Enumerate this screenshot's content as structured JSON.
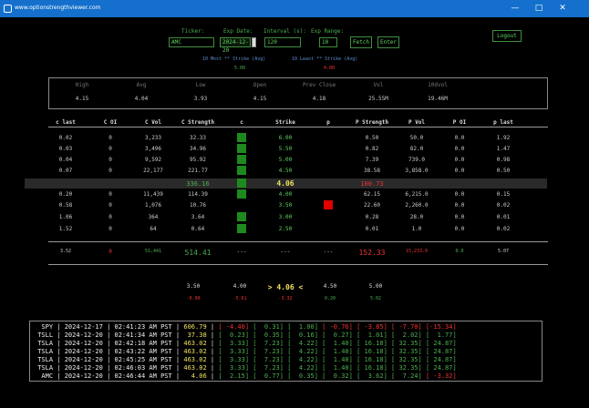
{
  "window": {
    "title": "www.optionstrengthviewer.com",
    "minimize": "—",
    "maximize": "□",
    "close": "✕"
  },
  "form": {
    "ticker_label": "Ticker:",
    "ticker_value": "AMC",
    "exp_label": "Exp Date:",
    "exp_value": "2024-12-20",
    "interval_label": "Interval (s):",
    "interval_value": "120",
    "range_label": "Exp Range:",
    "range_value": "10",
    "fetch": "Fetch",
    "enter": "Enter",
    "logout": "Logout"
  },
  "most": {
    "label": "10 Most ** Strike (Avg)",
    "value": "5.00"
  },
  "least": {
    "label": "10 Least ** Strike (Avg)",
    "value": "4.00"
  },
  "stats": {
    "headers": [
      "High",
      "Avg",
      "Low",
      "Open",
      "Prev Close",
      "Vol",
      "10dvol"
    ],
    "values": [
      "4.15",
      "4.04",
      "3.93",
      "4.15",
      "4.18",
      "25.55M",
      "19.46M"
    ]
  },
  "chain": {
    "headers": [
      "c last",
      "C OI",
      "C Vol",
      "C Strength",
      "c",
      "Strike",
      "p",
      "P Strength",
      "P Vol",
      "P OI",
      "p last"
    ],
    "rows": [
      [
        "0.02",
        "0",
        "3,233",
        "32.33",
        "6.00",
        "0.50",
        "50.0",
        "0.0",
        "1.92"
      ],
      [
        "0.03",
        "0",
        "3,496",
        "34.96",
        "5.50",
        "0.82",
        "82.0",
        "0.0",
        "1.47"
      ],
      [
        "0.04",
        "0",
        "9,592",
        "95.92",
        "5.00",
        "7.39",
        "739.0",
        "0.0",
        "0.98"
      ],
      [
        "0.07",
        "0",
        "22,177",
        "221.77",
        "4.50",
        "38.58",
        "3,858.0",
        "0.0",
        "0.50"
      ],
      [
        "0.20",
        "0",
        "11,439",
        "114.39",
        "4.00",
        "62.15",
        "6,215.0",
        "0.0",
        "0.15"
      ],
      [
        "0.58",
        "0",
        "1,076",
        "10.76",
        "3.50",
        "22.60",
        "2,260.0",
        "0.0",
        "0.02"
      ],
      [
        "1.06",
        "0",
        "364",
        "3.64",
        "3.00",
        "0.28",
        "28.0",
        "0.0",
        "0.01"
      ],
      [
        "1.52",
        "0",
        "64",
        "0.64",
        "2.50",
        "0.01",
        "1.0",
        "0.0",
        "0.02"
      ]
    ],
    "atm": {
      "c_strength": "336.16",
      "strike": "4.06",
      "p_strength": "100.73"
    },
    "totals": [
      "3.52",
      "0",
      "51,441",
      "514.41",
      "---",
      "---",
      "---",
      "152.33",
      "15,233.0",
      "0.0",
      "5.07"
    ],
    "colors": {
      "call": "#1e8a1e",
      "put": "#e00000"
    }
  },
  "ladder": {
    "strikes": [
      "3.50",
      "4.00",
      "> 4.06 <",
      "4.50",
      "5.00"
    ],
    "changes": [
      "-0.90",
      "-5.61",
      "-3.32",
      "0.20",
      "5.02"
    ]
  },
  "tickers": [
    {
      "sym": "SPY",
      "date": "2024-12-17",
      "time": "02:41:23 AM PST",
      "price": "606.79",
      "vals": [
        "-4.40",
        "0.31",
        "1.00",
        "-0.76",
        "-3.85",
        "-7.70",
        "-15.34"
      ]
    },
    {
      "sym": "TSLL",
      "date": "2024-12-20",
      "time": "02:41:34 AM PST",
      "price": "37.38",
      "vals": [
        "0.23",
        "0.35",
        "0.16",
        "0.27",
        "1.01",
        "2.02",
        "1.77"
      ]
    },
    {
      "sym": "TSLA",
      "date": "2024-12-20",
      "time": "02:42:18 AM PST",
      "price": "463.02",
      "vals": [
        "3.33",
        "7.23",
        "4.22",
        "1.40",
        "16.18",
        "32.35",
        "24.87"
      ]
    },
    {
      "sym": "TSLA",
      "date": "2024-12-20",
      "time": "02:43:22 AM PST",
      "price": "463.02",
      "vals": [
        "3.33",
        "7.23",
        "4.22",
        "1.40",
        "16.18",
        "32.35",
        "24.87"
      ]
    },
    {
      "sym": "TSLA",
      "date": "2024-12-20",
      "time": "02:45:25 AM PST",
      "price": "463.02",
      "vals": [
        "3.33",
        "7.23",
        "4.22",
        "1.40",
        "16.18",
        "32.35",
        "24.87"
      ]
    },
    {
      "sym": "TSLA",
      "date": "2024-12-20",
      "time": "02:46:03 AM PST",
      "price": "463.02",
      "vals": [
        "3.33",
        "7.23",
        "4.22",
        "1.40",
        "16.18",
        "32.35",
        "24.87"
      ]
    },
    {
      "sym": "AMC",
      "date": "2024-12-20",
      "time": "02:46:44 AM PST",
      "price": "4.06",
      "vals": [
        "2.15",
        "0.77",
        "0.35",
        "0.32",
        "3.62",
        "7.24",
        "-3.32"
      ]
    }
  ]
}
